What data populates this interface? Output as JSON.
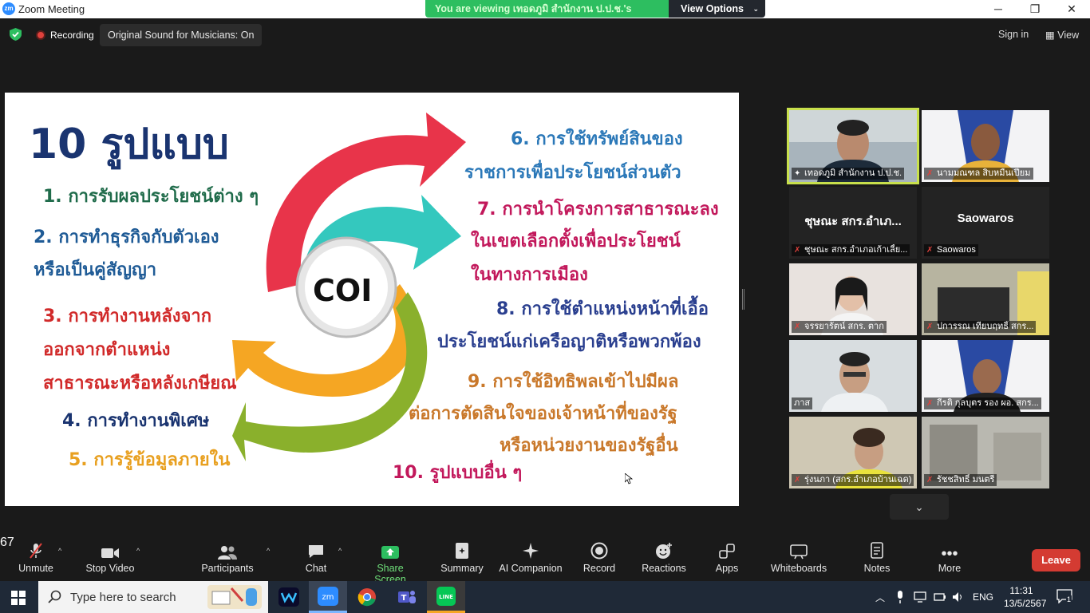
{
  "window": {
    "app_title": "Zoom Meeting",
    "minimize": "─",
    "restore": "❐",
    "close": "✕"
  },
  "share_banner": {
    "message": "You are viewing เทอดภูมิ สำนักงาน ป.ป.ช.'s screen",
    "view_options": "View Options"
  },
  "info_bar": {
    "recording": "Recording",
    "original_sound": "Original Sound for Musicians: On",
    "sign_in": "Sign in",
    "view": "View"
  },
  "slide": {
    "title": "10 รูปแบบ",
    "center_label": "COI",
    "items": [
      "1. การรับผลประโยชน์ต่าง ๆ",
      "2. การทำธุรกิจกับตัวเอง",
      "หรือเป็นคู่สัญญา",
      "3. การทำงานหลังจาก",
      "ออกจากตำแหน่ง",
      "สาธารณะหรือหลังเกษียณ",
      "4. การทำงานพิเศษ",
      "5. การรู้ข้อมูลภายใน",
      "6. การใช้ทรัพย์สินของ",
      "ราชการเพื่อประโยชน์ส่วนตัว",
      "7. การนำโครงการสาธารณะลง",
      "ในเขตเลือกตั้งเพื่อประโยชน์",
      "ในทางการเมือง",
      "8. การใช้ตำแหน่งหน้าที่เอื้อ",
      "ประโยชน์แก่เครือญาติหรือพวกพ้อง",
      "9. การใช้อิทธิพลเข้าไปมีผล",
      "ต่อการตัดสินใจของเจ้าหน้าที่ของรัฐ",
      "หรือหน่วยงานของรัฐอื่น",
      "10. รูปแบบอื่น ๆ"
    ]
  },
  "participants_tiles": [
    {
      "label": "เทอดภูมิ สำนักงาน ป.ป.ช.",
      "bigname": "",
      "muted": false,
      "active": true
    },
    {
      "label": "นามมณฑล สิบหมื่นเปี่ยม",
      "bigname": "",
      "muted": true
    },
    {
      "label": "ชุษณะ สกร.อำเภอเก้าเลี้ย...",
      "bigname": "ชุษณะ สกร.อำเภ...",
      "muted": true
    },
    {
      "label": "Saowaros",
      "bigname": "Saowaros",
      "muted": true
    },
    {
      "label": "จรรยารัตน์ สกร. ตาก",
      "bigname": "",
      "muted": true
    },
    {
      "label": "ปการรณ เทียบฤทธิ์ สกร...",
      "bigname": "",
      "muted": true
    },
    {
      "label": "ภาส",
      "bigname": "",
      "muted": false
    },
    {
      "label": "กีรติ กุลบุตร รอง ผอ. สกร...",
      "bigname": "",
      "muted": true
    },
    {
      "label": "รุ่งนภา (สกร.อำเภอบ้านเฉด)",
      "bigname": "",
      "muted": true
    },
    {
      "label": "รัชชสิทธิ์ มนตรี",
      "bigname": "",
      "muted": true
    }
  ],
  "toolbar": {
    "unmute": "Unmute",
    "stop_video": "Stop Video",
    "participants": "Participants",
    "participants_count": "67",
    "chat": "Chat",
    "share_screen": "Share Screen",
    "summary": "Summary",
    "ai_companion": "AI Companion",
    "record": "Record",
    "reactions": "Reactions",
    "apps": "Apps",
    "whiteboards": "Whiteboards",
    "notes": "Notes",
    "more": "More",
    "leave": "Leave"
  },
  "taskbar": {
    "search_placeholder": "Type here to search",
    "language": "ENG",
    "time": "11:31",
    "date": "13/5/2567",
    "notifications": "1"
  },
  "colors": {
    "share_green": "#2dbe60",
    "leave_red": "#d43b32",
    "active_speaker": "#c8e04c",
    "taskbar": "#1f2937"
  }
}
